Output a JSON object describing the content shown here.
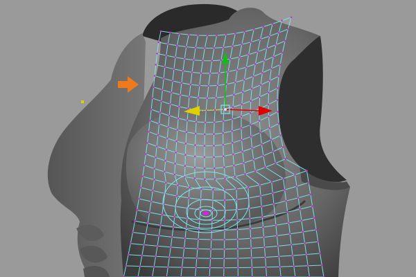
{
  "viewport": {
    "background": "#9a9a9a",
    "mesh_color": "#7fe6ee",
    "vertex_color": "#d02ad8",
    "annotation_arrow_color": "#f07a1a"
  },
  "manipulator": {
    "x_axis_color": "#e00000",
    "y_axis_color": "#10c010",
    "z_axis_color": "#e0d000",
    "center_color": "#e0e0e0"
  },
  "icons": [
    "annotation-arrow-icon",
    "move-manipulator-icon"
  ]
}
